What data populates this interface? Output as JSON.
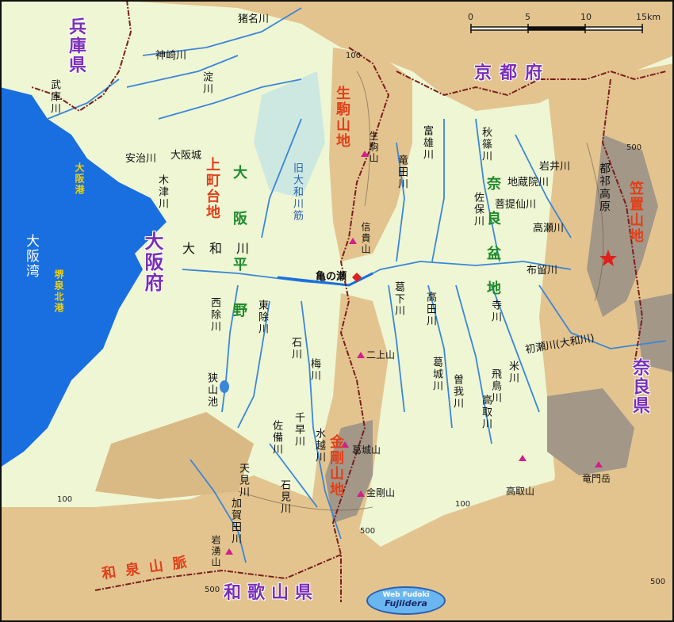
{
  "prefectures": {
    "hyogo": "兵庫県",
    "kyoto": "京都府",
    "osaka": "大阪府",
    "nara": "奈良県",
    "wakayama": "和歌山県"
  },
  "sea": {
    "osaka_bay": "大阪湾"
  },
  "ports": {
    "osaka_port": "大阪港",
    "sakai_senboku": "堺泉北港"
  },
  "mountains": {
    "ikoma": "生駒山地",
    "kongo": "金剛山地",
    "izumi": "和泉山脈",
    "kasagi": "笠置山地",
    "uemachi": "上町台地"
  },
  "plains": {
    "osaka_heiya": "大阪平野",
    "nara_bonchi": "奈良盆地"
  },
  "places": {
    "osaka_castle": "大阪城",
    "kamenose": "亀の瀬",
    "sayamaike": "狭山池",
    "tsuge": "都祁高原"
  },
  "peaks": {
    "ikoma": "生駒山",
    "shigi": "信貴山",
    "nijo": "二上山",
    "katsuragi": "葛城山",
    "kongo": "金剛山",
    "iwawaki": "岩湧山",
    "takatori": "高取山",
    "ryumon": "竜門岳"
  },
  "rivers": {
    "yodo": "淀川",
    "kanzaki": "神崎川",
    "ina": "猪名川",
    "muko": "武庫川",
    "aji": "安治川",
    "kizu": "木津川",
    "yamato": "大和川",
    "old_yamato": "旧大和川筋",
    "nishiyoke": "西除川",
    "higashiyoke": "東除川",
    "ishi": "石川",
    "umegawa": "梅川",
    "sabi": "佐備川",
    "chihaya": "千早川",
    "mizukoshi": "水越川",
    "amami": "天見川",
    "ishimi": "石見川",
    "kaga": "加賀田川",
    "tomio": "富雄川",
    "tatsuta": "竜田川",
    "katsuge": "葛下川",
    "takada": "高田川",
    "katsuragi": "葛城川",
    "soga": "曽我川",
    "takatori": "高取川",
    "asuka": "飛鳥川",
    "yoneno": "米川",
    "hatsuse": "初瀬川(大和川)",
    "tera": "寺川",
    "sao": "佐保川",
    "akishino": "秋篠川",
    "iwai": "岩井川",
    "jizoin": "地蔵院川",
    "bodaisen": "菩提仙川",
    "takase": "高瀬川",
    "meru": "布留川"
  },
  "contours": [
    "100",
    "500"
  ],
  "scale": {
    "ticks": [
      "0",
      "5",
      "10",
      "15km"
    ]
  },
  "logo": {
    "line1": "Web Fudoki",
    "line2": "Fujiidera"
  },
  "colors": {
    "water": "#1a6fe0",
    "lowland": "#eef6d4",
    "hill": "#e3c48f",
    "high": "#a39788",
    "prefecture_text": "#7a2fb8",
    "mountain_text": "#e0401a",
    "plain_text": "#1d8a2a"
  }
}
